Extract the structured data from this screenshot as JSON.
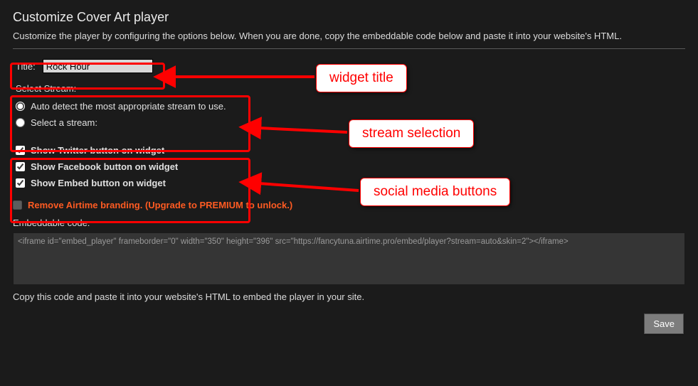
{
  "header": {
    "title": "Customize Cover Art player",
    "subtitle": "Customize the player by configuring the options below. When you are done, copy the embeddable code below and paste it into your website's HTML."
  },
  "title_field": {
    "label": "Title:",
    "value": "Rock Hour"
  },
  "stream": {
    "legend": "Select Stream:",
    "auto_label": "Auto detect the most appropriate stream to use.",
    "select_label": "Select a stream:",
    "selected": "auto"
  },
  "socials": {
    "twitter": {
      "label": "Show Twitter button on widget",
      "checked": true
    },
    "facebook": {
      "label": "Show Facebook button on widget",
      "checked": true
    },
    "embed": {
      "label": "Show Embed button on widget",
      "checked": true
    }
  },
  "branding": {
    "label": "Remove Airtime branding. (Upgrade to PREMIUM to unlock.)",
    "checked": false,
    "enabled": false
  },
  "embed": {
    "label": "Embeddable code:",
    "code": "<iframe id=\"embed_player\" frameborder=\"0\" width=\"350\" height=\"396\" src=\"https://fancytuna.airtime.pro/embed/player?stream=auto&skin=2\"></iframe>",
    "hint": "Copy this code and paste it into your website's HTML to embed the player in your site."
  },
  "buttons": {
    "save": "Save"
  },
  "annotations": {
    "a1": "widget title",
    "a2": "stream selection",
    "a3": "social media buttons"
  }
}
